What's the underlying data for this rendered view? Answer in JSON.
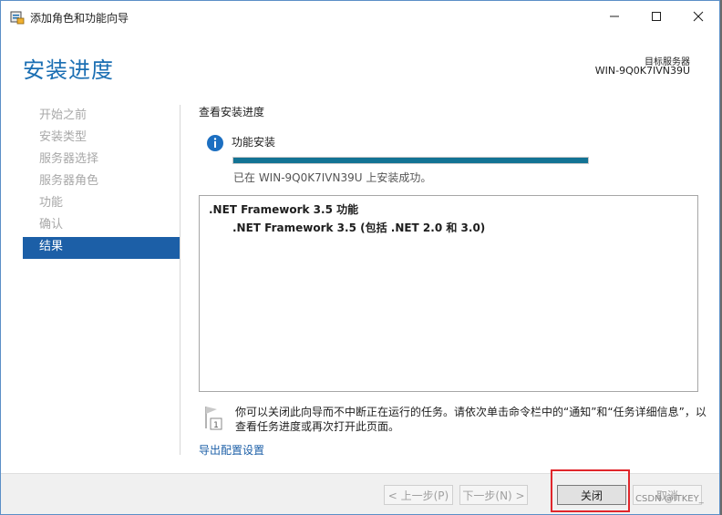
{
  "window": {
    "title": "添加角色和功能向导"
  },
  "header": {
    "page_title": "安装进度",
    "target_label": "目标服务器",
    "target_name": "WIN-9Q0K7IVN39U"
  },
  "nav": {
    "items": [
      {
        "label": "开始之前",
        "active": false
      },
      {
        "label": "安装类型",
        "active": false
      },
      {
        "label": "服务器选择",
        "active": false
      },
      {
        "label": "服务器角色",
        "active": false
      },
      {
        "label": "功能",
        "active": false
      },
      {
        "label": "确认",
        "active": false
      },
      {
        "label": "结果",
        "active": true
      }
    ]
  },
  "content": {
    "section_title": "查看安装进度",
    "feature_label": "功能安装",
    "progress_percent": 100,
    "status_line": "已在 WIN-9Q0K7IVN39U 上安装成功。",
    "results": {
      "line1": ".NET Framework 3.5 功能",
      "line2": ".NET Framework 3.5 (包括 .NET 2.0 和 3.0)"
    },
    "note": "你可以关闭此向导而不中断正在运行的任务。请依次单击命令栏中的“通知”和“任务详细信息”，以查看任务进度或再次打开此页面。",
    "export_link": "导出配置设置"
  },
  "footer": {
    "prev_label": "< 上一步(P)",
    "next_label": "下一步(N) >",
    "close_label": "关闭",
    "cancel_label": "取消"
  },
  "watermark": "CSDN @ITKEY_",
  "colors": {
    "accent": "#1b6fb3",
    "nav_active": "#1c5fa7",
    "progress": "#137394",
    "highlight": "#e0262b"
  }
}
